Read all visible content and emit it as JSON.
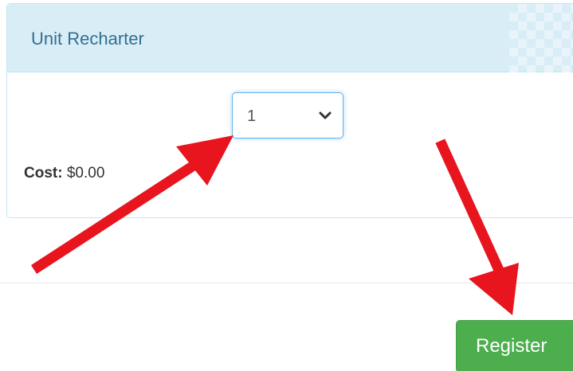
{
  "panel": {
    "title": "Unit Recharter"
  },
  "selector": {
    "value": "1",
    "icon": "chevron-down-icon"
  },
  "cost": {
    "label": "Cost:",
    "value": "$0.00"
  },
  "footer": {
    "register_label": "Register"
  },
  "colors": {
    "panel_heading_bg": "#d9edf7",
    "panel_title": "#31708f",
    "button_green": "#4cae4c",
    "arrow_red": "#e8141e"
  }
}
